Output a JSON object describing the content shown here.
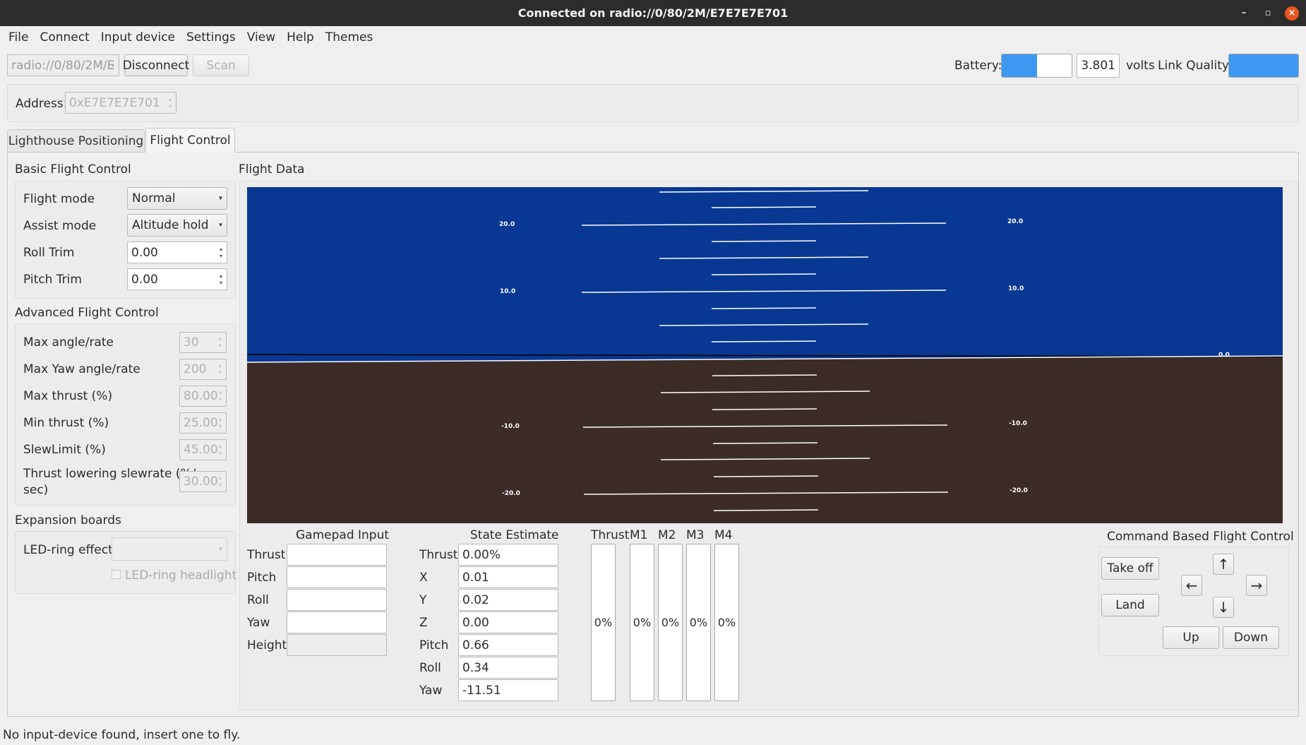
{
  "window": {
    "title": "Connected on radio://0/80/2M/E7E7E7E701"
  },
  "menu": [
    "File",
    "Connect",
    "Input device",
    "Settings",
    "View",
    "Help",
    "Themes"
  ],
  "toolbar": {
    "uri": "radio://0/80/2M/E",
    "disconnect_label": "Disconnect",
    "scan_label": "Scan",
    "battery_label": "Battery:",
    "battery_level": 0.5,
    "voltage": "3.801",
    "volts_label": "volts",
    "link_quality_label": "Link Quality:",
    "link_quality_level": 1.0,
    "accent_color": "#3d98f0"
  },
  "address": {
    "label": "Address:",
    "value": "0xE7E7E7E701"
  },
  "tabs": [
    "Lighthouse Positioning",
    "Flight Control"
  ],
  "basic": {
    "title": "Basic Flight Control",
    "flight_mode_label": "Flight mode",
    "flight_mode_value": "Normal",
    "assist_mode_label": "Assist mode",
    "assist_mode_value": "Altitude hold",
    "roll_trim_label": "Roll Trim",
    "roll_trim_value": "0.00",
    "pitch_trim_label": "Pitch Trim",
    "pitch_trim_value": "0.00"
  },
  "advanced": {
    "title": "Advanced Flight Control",
    "max_angle_label": "Max angle/rate",
    "max_angle_value": "30",
    "max_yaw_label": "Max Yaw angle/rate",
    "max_yaw_value": "200",
    "max_thrust_label": "Max thrust (%)",
    "max_thrust_value": "80.00",
    "min_thrust_label": "Min thrust (%)",
    "min_thrust_value": "25.00",
    "slew_label": "SlewLimit (%)",
    "slew_value": "45.00",
    "thrust_lowering_label_1": "Thrust lowering slewrate (%/",
    "thrust_lowering_label_2": "sec)",
    "thrust_lowering_value": "30.00"
  },
  "expansion": {
    "title": "Expansion boards",
    "led_ring_label": "LED-ring effect",
    "led_headlight_label": "LED-ring headlight"
  },
  "flight_data": {
    "title": "Flight Data",
    "horizon": {
      "sky_color": "#083893",
      "ground_color": "#3c2b27",
      "pitch_labels_left": [
        "20.0",
        "10.0",
        "-10.0",
        "-20.0"
      ],
      "pitch_labels_right": [
        "20.0",
        "10.0",
        "-10.0",
        "-20.0"
      ],
      "roll_label": "0.0"
    }
  },
  "gamepad": {
    "title": "Gamepad Input",
    "rows": [
      "Thrust",
      "Pitch",
      "Roll",
      "Yaw",
      "Height"
    ]
  },
  "state": {
    "title": "State Estimate",
    "rows": [
      {
        "label": "Thrust",
        "value": "0.00%"
      },
      {
        "label": "X",
        "value": "0.01"
      },
      {
        "label": "Y",
        "value": "0.02"
      },
      {
        "label": "Z",
        "value": "0.00"
      },
      {
        "label": "Pitch",
        "value": "0.66"
      },
      {
        "label": "Roll",
        "value": "0.34"
      },
      {
        "label": "Yaw",
        "value": "-11.51"
      }
    ]
  },
  "motors": [
    {
      "label": "Thrust",
      "value": "0%"
    },
    {
      "label": "M1",
      "value": "0%"
    },
    {
      "label": "M2",
      "value": "0%"
    },
    {
      "label": "M3",
      "value": "0%"
    },
    {
      "label": "M4",
      "value": "0%"
    }
  ],
  "command": {
    "title": "Command Based Flight Control",
    "takeoff_label": "Take off",
    "land_label": "Land",
    "up_label": "Up",
    "down_label": "Down",
    "arrow_up": "↑",
    "arrow_down": "↓",
    "arrow_left": "←",
    "arrow_right": "→"
  },
  "status": {
    "text": "No input-device found, insert one to fly."
  }
}
